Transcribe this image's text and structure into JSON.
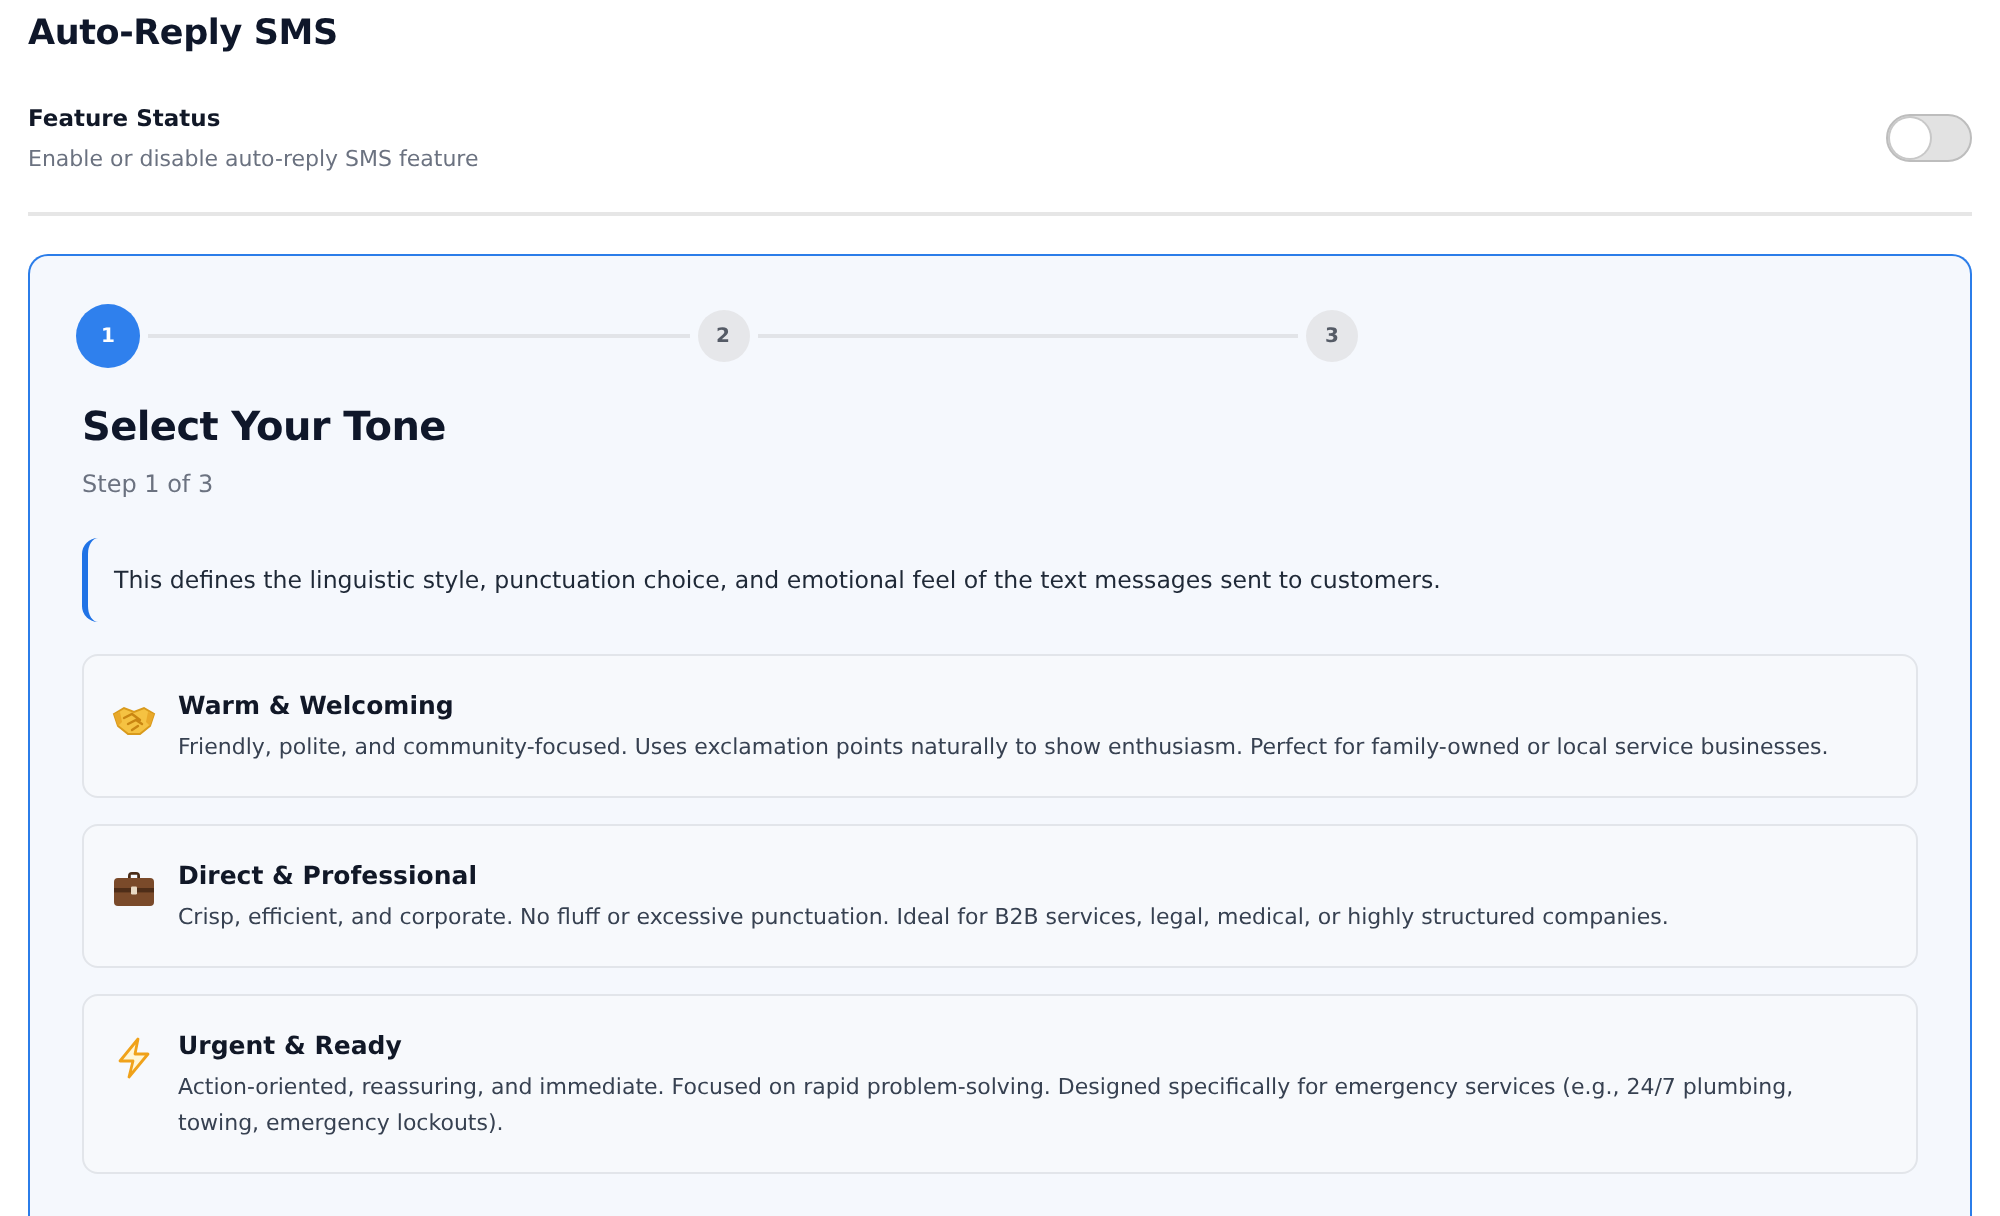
{
  "page": {
    "title": "Auto-Reply SMS"
  },
  "feature": {
    "label": "Feature Status",
    "description": "Enable or disable auto-reply SMS feature",
    "on": false
  },
  "wizard": {
    "steps": [
      {
        "label": "1",
        "selected": true
      },
      {
        "label": "2",
        "selected": false
      },
      {
        "label": "3",
        "selected": false
      }
    ],
    "heading": "Select Your Tone",
    "step_counter": "Step 1 of 3",
    "info": "This defines the linguistic style, punctuation choice, and emotional feel of the text messages sent to customers.",
    "tones": [
      {
        "title": "Warm & Welcoming",
        "description": "Friendly, polite, and community-focused. Uses exclamation points naturally to show enthusiasm. Perfect for family-owned or local service businesses.",
        "selected": false
      },
      {
        "title": "Direct & Professional",
        "description": "Crisp, efficient, and corporate. No fluff or excessive punctuation. Ideal for B2B services, legal, medical, or highly structured companies.",
        "selected": false
      },
      {
        "title": "Urgent & Ready",
        "description": "Action-oriented, reassuring, and immediate. Focused on rapid problem-solving. Designed specifically for emergency services (e.g., 24/7 plumbing, towing, emergency lockouts).",
        "selected": false
      }
    ]
  }
}
